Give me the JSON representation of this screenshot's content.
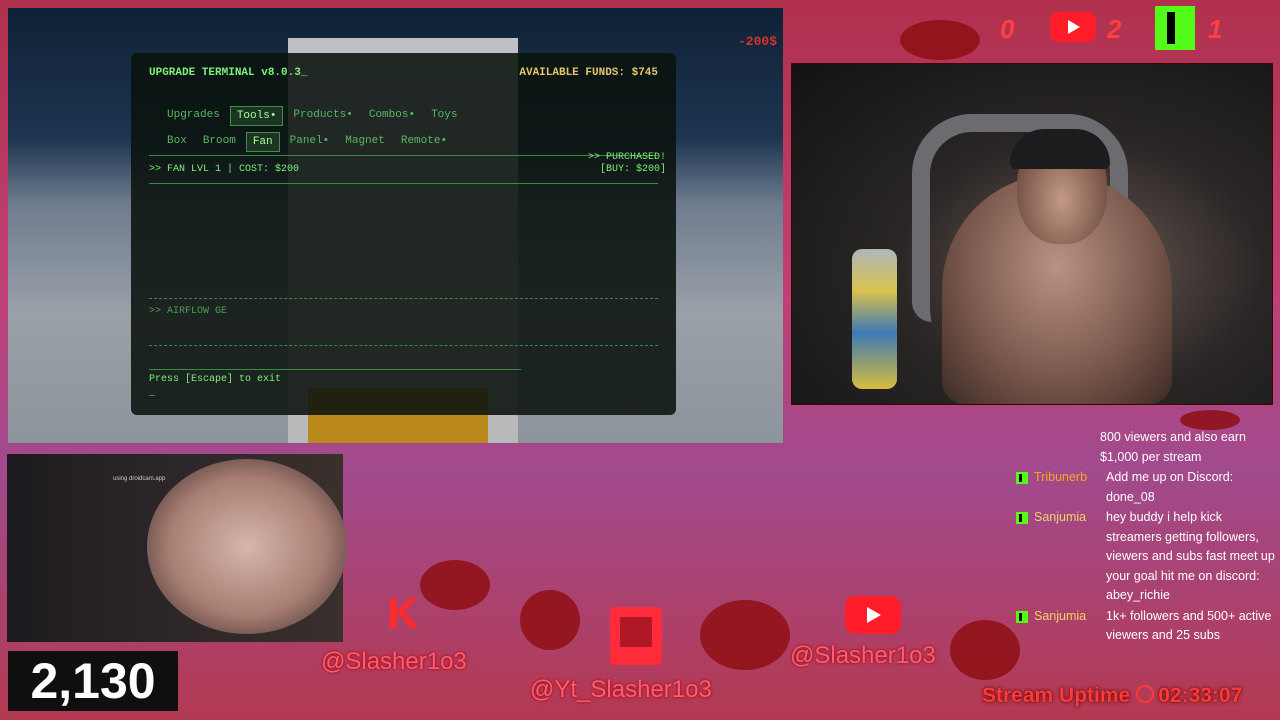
{
  "terminal": {
    "title": "UPGRADE TERMINAL v8.0.3_",
    "funds": "AVAILABLE FUNDS: $745",
    "tabs_row1": [
      {
        "label": "Upgrades",
        "active": false
      },
      {
        "label": "Tools•",
        "active": true
      },
      {
        "label": "Products•",
        "active": false
      },
      {
        "label": "Combos•",
        "active": false
      },
      {
        "label": "Toys",
        "active": false
      }
    ],
    "tabs_row2": [
      {
        "label": "Box",
        "active": false
      },
      {
        "label": "Broom",
        "active": false
      },
      {
        "label": "Fan",
        "active": true
      },
      {
        "label": "Panel•",
        "active": false
      },
      {
        "label": "Magnet",
        "active": false
      },
      {
        "label": "Remote•",
        "active": false
      }
    ],
    "item_line": ">> FAN LVL 1 | COST: $200",
    "purchased": ">> PURCHASED!",
    "buy": "[BUY: $200]",
    "airflow": ">> AIRFLOW GE",
    "exit_hint": "Press [Escape] to exit",
    "cursor": "_"
  },
  "game": {
    "float_text": "-200$"
  },
  "webcam_small": {
    "overlay": "using droidcam.app"
  },
  "viewers": {
    "count": "2,130"
  },
  "socials": {
    "kick_handle": "@Slasher1o3",
    "twitch_handle": "@Yt_Slasher1o3",
    "youtube_handle": "@Slasher1o3"
  },
  "top_right": {
    "num1": "0",
    "num2": "2",
    "num3": "1"
  },
  "chat": [
    {
      "user": "",
      "text": "800 viewers and also earn $1,000 per stream",
      "continuation": true
    },
    {
      "user": "Tribunerb",
      "text": "Add me up on Discord: done_08",
      "user_color": "#f5a623"
    },
    {
      "user": "Sanjumia",
      "text": "hey buddy i help kick streamers getting followers, viewers and subs fast meet up your goal hit me on discord: abey_richie",
      "user_color": "#f0d36b"
    },
    {
      "user": "Sanjumia",
      "text": "1k+ followers and 500+ active viewers and 25 subs",
      "user_color": "#f0d36b"
    }
  ],
  "uptime": {
    "label": "Stream Uptime",
    "time": "02:33:07"
  },
  "colors": {
    "terminal_green": "#7ef07a",
    "funds_yellow": "#e3c66b",
    "kick_green": "#53fc18",
    "accent_red": "#ff3a3a"
  }
}
